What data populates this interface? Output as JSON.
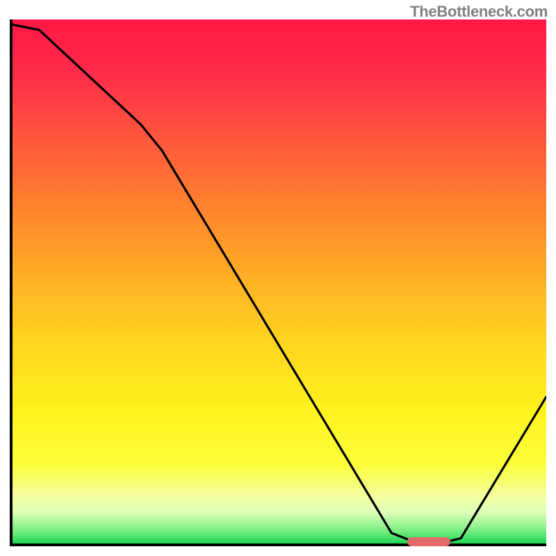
{
  "attribution": "TheBottleneck.com",
  "chart_data": {
    "type": "line",
    "title": "",
    "xlabel": "",
    "ylabel": "",
    "xlim": [
      0,
      100
    ],
    "ylim": [
      0,
      100
    ],
    "x": [
      0,
      5,
      24,
      28,
      71,
      76,
      80,
      84,
      100
    ],
    "values": [
      99,
      98,
      80,
      75,
      2,
      0,
      0,
      1,
      28
    ],
    "marker": {
      "x_start": 74,
      "x_end": 82,
      "y": 0,
      "color": "#e26a6a"
    },
    "gradient_stops": [
      {
        "pct": 0,
        "color": "#ff1744"
      },
      {
        "pct": 10,
        "color": "#ff2b4a"
      },
      {
        "pct": 25,
        "color": "#ff5e3a"
      },
      {
        "pct": 38,
        "color": "#ff8a2b"
      },
      {
        "pct": 50,
        "color": "#ffb224"
      },
      {
        "pct": 62,
        "color": "#ffd61f"
      },
      {
        "pct": 75,
        "color": "#fff31f"
      },
      {
        "pct": 85,
        "color": "#fbff3a"
      },
      {
        "pct": 91,
        "color": "#f4ffa0"
      },
      {
        "pct": 94,
        "color": "#ddffb8"
      },
      {
        "pct": 97,
        "color": "#8cf28c"
      },
      {
        "pct": 100,
        "color": "#1fd655"
      }
    ]
  }
}
